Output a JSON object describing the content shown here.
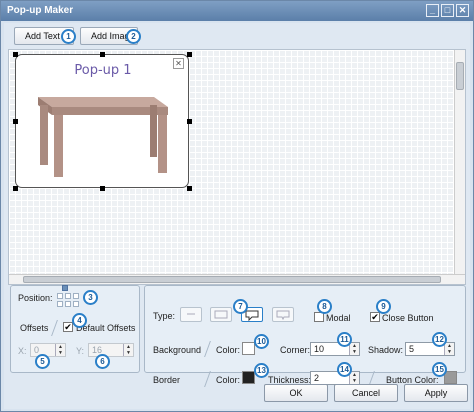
{
  "window": {
    "title": "Pop-up Maker",
    "controls": [
      "_",
      "□",
      "✕"
    ]
  },
  "toolbar": {
    "add_text": "Add Text",
    "add_image": "Add Imag"
  },
  "popup": {
    "title": "Pop-up 1",
    "close_glyph": "✕"
  },
  "position_panel": {
    "position_label": "Position:",
    "offsets_label": "Offsets",
    "default_offsets_label": "Default Offsets",
    "default_offsets_checked": true,
    "x_label": "X:",
    "x_value": "0",
    "y_label": "Y:",
    "y_value": "16"
  },
  "style_panel": {
    "type_label": "Type:",
    "modal_label": "Modal",
    "modal_checked": false,
    "close_button_label": "Close Button",
    "close_button_checked": true,
    "background_label": "Background",
    "bg_color_label": "Color:",
    "bg_color": "#ffffff",
    "corner_label": "Corner:",
    "corner_value": "10",
    "shadow_label": "Shadow:",
    "shadow_value": "5",
    "border_label": "Border",
    "border_color_label": "Color:",
    "border_color": "#222222",
    "thickness_label": "Thickness:",
    "thickness_value": "2",
    "button_color_label": "Button Color:",
    "button_color": "#9a9a9a"
  },
  "buttons": {
    "ok": "OK",
    "cancel": "Cancel",
    "apply": "Apply"
  },
  "callouts": [
    "1",
    "2",
    "3",
    "4",
    "5",
    "6",
    "7",
    "8",
    "9",
    "10",
    "11",
    "12",
    "13",
    "14",
    "15"
  ],
  "colors": {
    "accent": "#2a7fc8",
    "titlebar": "#5b7fa9",
    "table": "#b39287"
  }
}
